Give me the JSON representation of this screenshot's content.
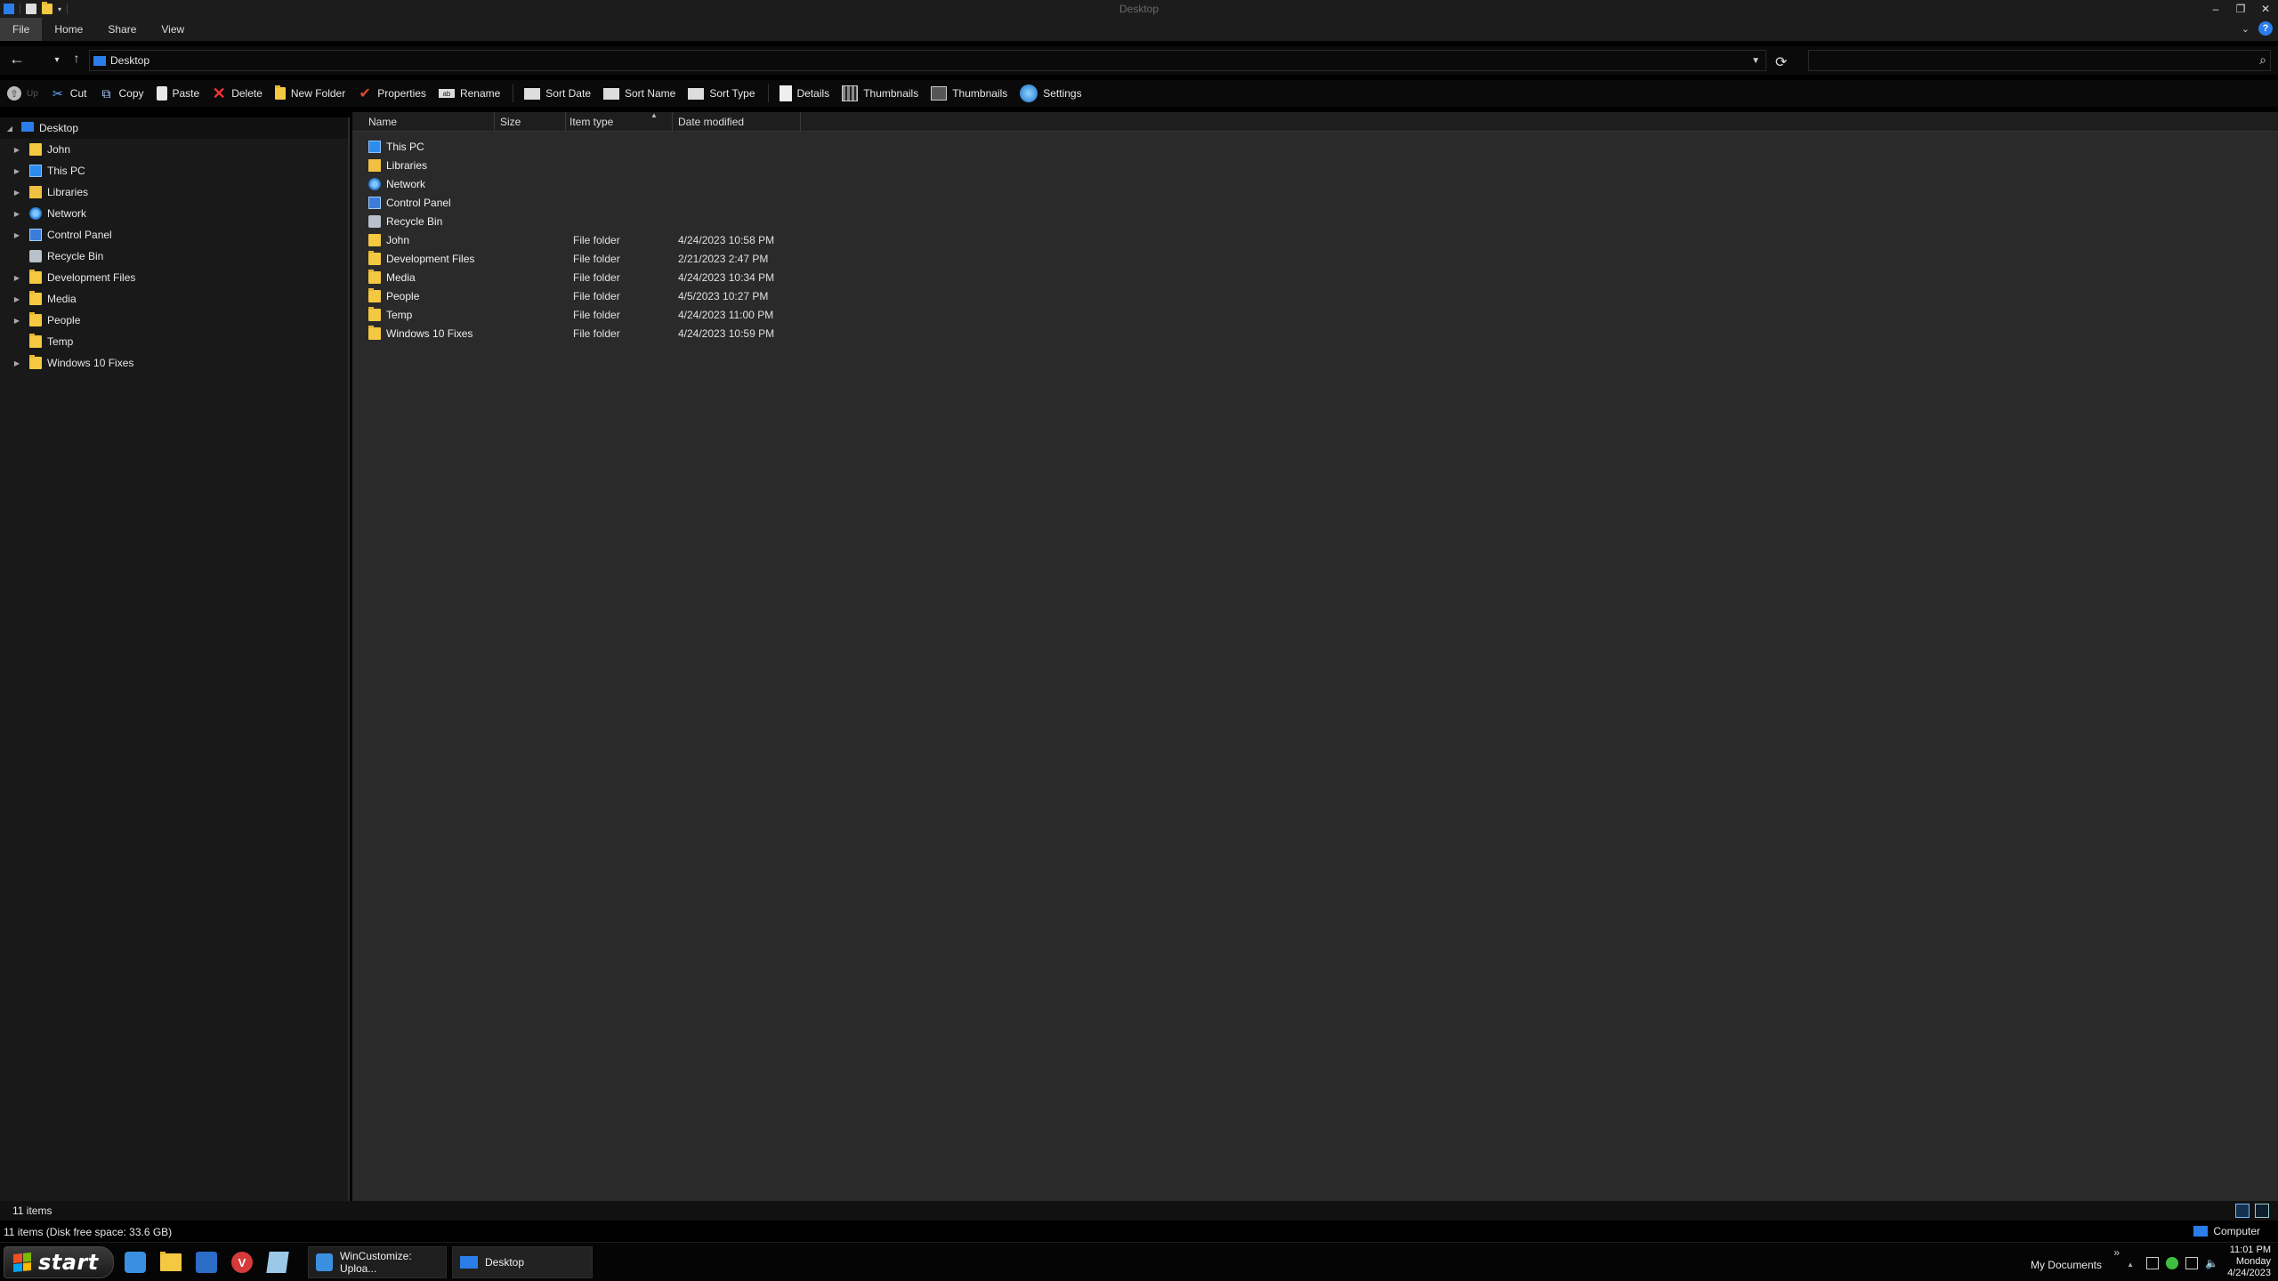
{
  "window": {
    "title": "Desktop"
  },
  "ribbon": {
    "tabs": [
      {
        "label": "File"
      },
      {
        "label": "Home"
      },
      {
        "label": "Share"
      },
      {
        "label": "View"
      }
    ],
    "help_label": "?"
  },
  "address": {
    "path": "Desktop",
    "search_placeholder": ""
  },
  "toolbar": {
    "up": "Up",
    "cut": "Cut",
    "copy": "Copy",
    "paste": "Paste",
    "delete": "Delete",
    "new_folder": "New Folder",
    "properties": "Properties",
    "rename": "Rename",
    "sort_date": "Sort Date",
    "sort_name": "Sort Name",
    "sort_type": "Sort Type",
    "details": "Details",
    "thumbnails1": "Thumbnails",
    "thumbnails2": "Thumbnails",
    "settings": "Settings"
  },
  "nav": {
    "root": "Desktop",
    "items": [
      {
        "label": "John",
        "icon": "user-folder-icon",
        "expandable": true
      },
      {
        "label": "This PC",
        "icon": "computer-icon",
        "expandable": true
      },
      {
        "label": "Libraries",
        "icon": "library-icon",
        "expandable": true
      },
      {
        "label": "Network",
        "icon": "network-icon",
        "expandable": true
      },
      {
        "label": "Control Panel",
        "icon": "control-panel-icon",
        "expandable": true
      },
      {
        "label": "Recycle Bin",
        "icon": "recycle-bin-icon",
        "expandable": false
      },
      {
        "label": "Development Files",
        "icon": "folder-icon",
        "expandable": true
      },
      {
        "label": "Media",
        "icon": "folder-icon",
        "expandable": true
      },
      {
        "label": "People",
        "icon": "folder-icon",
        "expandable": true
      },
      {
        "label": "Temp",
        "icon": "folder-icon",
        "expandable": false
      },
      {
        "label": "Windows 10 Fixes",
        "icon": "folder-icon",
        "expandable": true
      }
    ]
  },
  "columns": {
    "name": "Name",
    "size": "Size",
    "type": "Item type",
    "date": "Date modified"
  },
  "files": [
    {
      "name": "This PC",
      "type": "",
      "date": "",
      "icon": "computer-icon"
    },
    {
      "name": "Libraries",
      "type": "",
      "date": "",
      "icon": "library-icon"
    },
    {
      "name": "Network",
      "type": "",
      "date": "",
      "icon": "network-icon"
    },
    {
      "name": "Control Panel",
      "type": "",
      "date": "",
      "icon": "control-panel-icon"
    },
    {
      "name": "Recycle Bin",
      "type": "",
      "date": "",
      "icon": "recycle-bin-icon"
    },
    {
      "name": "John",
      "type": "File folder",
      "date": "4/24/2023 10:58 PM",
      "icon": "user-folder-icon"
    },
    {
      "name": "Development Files",
      "type": "File folder",
      "date": "2/21/2023 2:47 PM",
      "icon": "folder-icon"
    },
    {
      "name": "Media",
      "type": "File folder",
      "date": "4/24/2023 10:34 PM",
      "icon": "folder-icon"
    },
    {
      "name": "People",
      "type": "File folder",
      "date": "4/5/2023 10:27 PM",
      "icon": "folder-icon"
    },
    {
      "name": "Temp",
      "type": "File folder",
      "date": "4/24/2023 11:00 PM",
      "icon": "folder-icon"
    },
    {
      "name": "Windows 10 Fixes",
      "type": "File folder",
      "date": "4/24/2023 10:59 PM",
      "icon": "folder-icon"
    }
  ],
  "status": {
    "count": "11 items",
    "detail": "11 items (Disk free space: 33.6 GB)",
    "computer": "Computer"
  },
  "taskbar": {
    "start": "start",
    "tasks": [
      {
        "label": "WinCustomize: Uploa..."
      },
      {
        "label": "Desktop"
      }
    ],
    "tray_label": "My Documents",
    "clock_time": "11:01 PM",
    "clock_day": "Monday",
    "clock_date": "4/24/2023"
  },
  "colors": {
    "accent": "#2b7de9",
    "folder": "#f5c842",
    "background": "#2a2a2a"
  }
}
